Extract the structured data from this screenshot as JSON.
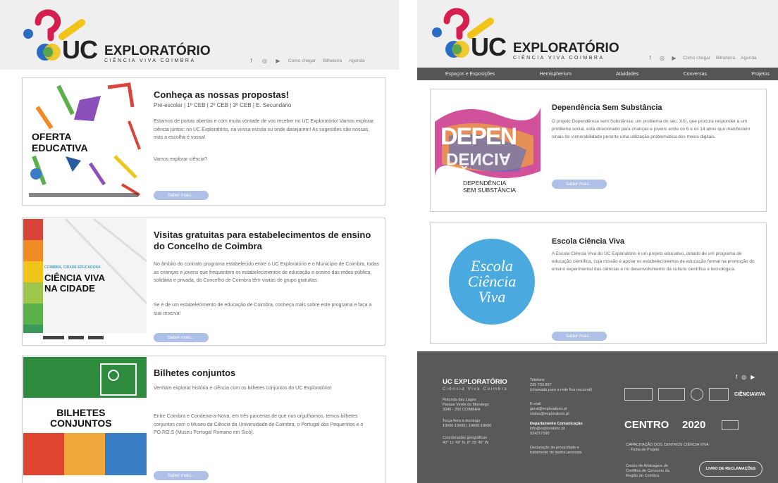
{
  "left": {
    "brand": {
      "uc": "UC",
      "name": "EXPLORATÓRIO",
      "sub": "CIÊNCIA VIVA COIMBRA"
    },
    "nav": [
      "Como chegar",
      "Bilheteira",
      "Agenda"
    ],
    "icons": [
      "facebook-icon",
      "instagram-icon",
      "youtube-icon"
    ],
    "cards": [
      {
        "title": "Conheça as nossas propostas!",
        "subtitle": "Pré-escolar | 1º CEB | 2º CEB | 3º CEB | E. Secundário",
        "body": [
          "Estamos de portas abertas e com muita vontade de vos receber no UC Exploratório! Vamos explorar ciência juntos: no UC Exploratório, na vossa escola ou onde desejarem! As sugestões são nossas, mas a escolha é vossa!",
          "Vamos explorar ciência?"
        ],
        "image_text": "OFERTA\nEDUCATIVA",
        "button": "Saber mais..."
      },
      {
        "title": "Visitas gratuitas para estabelecimentos de ensino do Concelho de Coimbra",
        "body": [
          "No âmbito do contrato programa estabelecido entre o UC Exploratório e o Município de Coimbra, todas as crianças e jovens que frequentem os estabelecimentos de educação e ensino das redes pública, solidária e privada, do Concelho de Coimbra têm visitas de grupo gratuitas.",
          "Se é de um estabelecimento de educação de Coimbra, conheça mais sobre este programa e faça a sua reserva!"
        ],
        "image_kicker": "COIMBRA, CIDADE EDUCADORA",
        "image_text": "CIÊNCIA VIVA\nNA CIDADE",
        "button": "Saber mais..."
      },
      {
        "title": "Bilhetes conjuntos",
        "body": [
          "Venham explorar história e ciência com os bilhetes conjuntos do UC Exploratório!",
          "Entre Coimbra e Condeixa-a-Nova, em três parcerias de que nos orgulhamos, temos bilhetes conjuntos com o Museu da Ciência da Universidade de Coimbra, o Portugal dos Pequenitos e o PO.RO.S (Museu Portugal Romano em Sicó)."
        ],
        "image_text": "BILHETES\nCONJUNTOS",
        "button": "Saber mais..."
      }
    ]
  },
  "right": {
    "brand": {
      "uc": "UC",
      "name": "EXPLORATÓRIO",
      "sub": "CIÊNCIA VIVA COIMBRA"
    },
    "nav": [
      "Como chegar",
      "Bilheteira",
      "Agenda"
    ],
    "menu": [
      "Espaços e Exposições",
      "Hemispherium",
      "Atividades",
      "Conversas",
      "Projetos"
    ],
    "cards": [
      {
        "title": "Dependência Sem Substância",
        "body": "O projeto Dependência sem Substância: um problema do séc. XXI, que procura responder a um problema social, está direcionado para crianças e jovens entre os 6 e os 14 anos que manifestem sinais de vulnerabilidade perante uma utilização problemática dos meios digitais.",
        "image_big": "DEPEN",
        "image_big2": "DÊNCIA",
        "image_caption": "DEPENDÊNCIA\nSEM SUBSTÂNCIA",
        "button": "Saber mais..."
      },
      {
        "title": "Escola Ciência Viva",
        "body": "A Escola Ciência Viva do UC Exploratório é um projeto educativo, dotado de um programa de educação científica, cuja missão é apoiar os estabelecimentos de educação formal na promoção do ensino experimental das ciências e no desenvolvimento da cultura científica e tecnológica.",
        "image_text": "Escola\nCiência\nViva",
        "button": "Saber mais..."
      }
    ],
    "footer": {
      "brand": "UC EXPLORATÓRIO",
      "brand_sub": "Ciência Viva Coimbra",
      "address": "Rotunda das Lages\nParque Verde do Mondego\n3040 - 250 COIMBRA",
      "hours": "Terça-feira a domingo\n10h00-13h00 | 14h00-18h00",
      "coords_label": "Coordenadas geográficas",
      "coords": "40° 11' 49\" N, 8° 25' 45\" W",
      "phone_label": "Telefone",
      "phone": "239 703 897",
      "phone_note": "(chamada para a rede fixa nacional)",
      "email_label": "E-mail",
      "emails": "geral@exploratorio.pt\nvisitas@exploratorio.pt",
      "dept": "Departamento Comunicação",
      "dept_contact": "info@exploratorio.pt\n934317590",
      "privacy": "Declaração de privacidade e\ntratamento de dados pessoais",
      "social_icons": [
        "facebook-icon",
        "instagram-icon",
        "youtube-icon"
      ],
      "partners": "CIÊNCIAVIVA",
      "centro": "CENTRO",
      "portugal": "2020",
      "capacitacao": "CAPACITAÇÃO DOS CENTROS CIÊNCIA VIVA",
      "ficha": "- Ficha de Projeto",
      "arbitragem": "Centro de Arbitragem de\nConflitos de Consumo da\nRegião de Coimbra",
      "reclamacoes": "LIVRO DE RECLAMAÇÕES"
    }
  },
  "colors": {
    "header_bg": "#efefef",
    "navbar": "#555555",
    "footer": "#595959",
    "button": "#aebfe8",
    "logo_red": "#d41f4f",
    "logo_yellow": "#f0c419",
    "logo_blue": "#2a6cc4",
    "logo_green": "#58a84b"
  }
}
